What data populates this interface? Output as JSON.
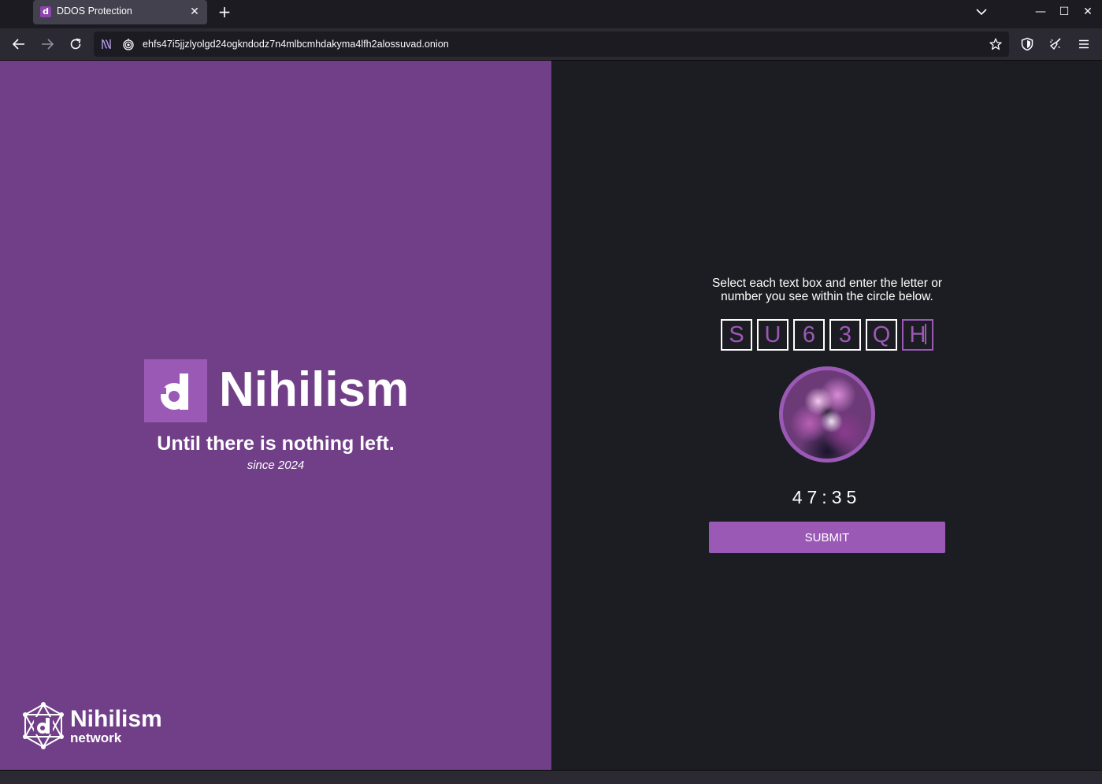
{
  "browser": {
    "tab_title": "DDOS Protection",
    "tab_favicon_letter": "d",
    "tab_close_glyph": "✕",
    "new_tab_glyph": "+",
    "url": "ehfs47i5jjzlyolgd24ogkndodz7n4mlbcmhdakyma4lfh2alossuvad.onion",
    "window_controls": {
      "minimize": "—",
      "maximize": "☐",
      "close": "✕"
    },
    "icons": [
      "back-icon",
      "forward-icon",
      "reload-icon",
      "tor-circuit-icon",
      "onion-icon",
      "bookmark-star-icon",
      "shield-icon",
      "new-identity-broom-icon",
      "menu-icon",
      "tab-list-chevron-icon"
    ]
  },
  "branding": {
    "title": "Nihilism",
    "tagline": "Until there is nothing left.",
    "since": "since 2024",
    "network_title": "Nihilism",
    "network_subtitle": "network",
    "accent_color": "#9b59b6",
    "panel_color": "#713f88"
  },
  "captcha": {
    "instructions": "Select each text box and enter the letter or number you see within the circle below.",
    "chars": [
      "S",
      "U",
      "6",
      "3",
      "Q",
      "H"
    ],
    "active_index": 5,
    "timer": "47:35",
    "submit_label": "SUBMIT"
  }
}
